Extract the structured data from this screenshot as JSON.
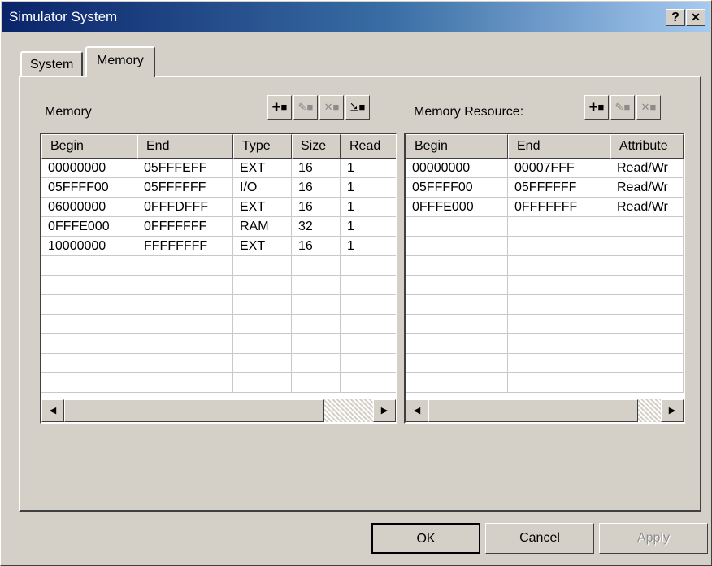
{
  "window": {
    "title": "Simulator System",
    "help_label": "?",
    "close_label": "✕"
  },
  "tabs": [
    {
      "label": "System",
      "active": false
    },
    {
      "label": "Memory",
      "active": true
    }
  ],
  "memory": {
    "label": "Memory",
    "toolbar": [
      {
        "name": "add",
        "label": "✚■",
        "enabled": true
      },
      {
        "name": "modify",
        "label": "✎■",
        "enabled": false
      },
      {
        "name": "delete",
        "label": "✕■",
        "enabled": false
      },
      {
        "name": "select",
        "label": "⇲■",
        "enabled": true
      }
    ],
    "columns": [
      "Begin",
      "End",
      "Type",
      "Size",
      "Read"
    ],
    "rows": [
      [
        "00000000",
        "05FFFEFF",
        "EXT",
        "16",
        "1"
      ],
      [
        "05FFFF00",
        "05FFFFFF",
        "I/O",
        "16",
        "1"
      ],
      [
        "06000000",
        "0FFFDFFF",
        "EXT",
        "16",
        "1"
      ],
      [
        "0FFFE000",
        "0FFFFFFF",
        "RAM",
        "32",
        "1"
      ],
      [
        "10000000",
        "FFFFFFFF",
        "EXT",
        "16",
        "1"
      ]
    ]
  },
  "resource": {
    "label": "Memory Resource:",
    "toolbar": [
      {
        "name": "add",
        "label": "✚■",
        "enabled": true
      },
      {
        "name": "modify",
        "label": "✎■",
        "enabled": false
      },
      {
        "name": "delete",
        "label": "✕■",
        "enabled": false
      }
    ],
    "columns": [
      "Begin",
      "End",
      "Attribute"
    ],
    "rows": [
      [
        "00000000",
        "00007FFF",
        "Read/Wr"
      ],
      [
        "05FFFF00",
        "05FFFFFF",
        "Read/Wr"
      ],
      [
        "0FFFE000",
        "0FFFFFFF",
        "Read/Wr"
      ]
    ]
  },
  "buttons": {
    "ok": "OK",
    "cancel": "Cancel",
    "apply": "Apply"
  },
  "colors": {
    "titlebar_start": "#0a246a",
    "titlebar_end": "#a6caf0",
    "face": "#d4d0c8"
  }
}
